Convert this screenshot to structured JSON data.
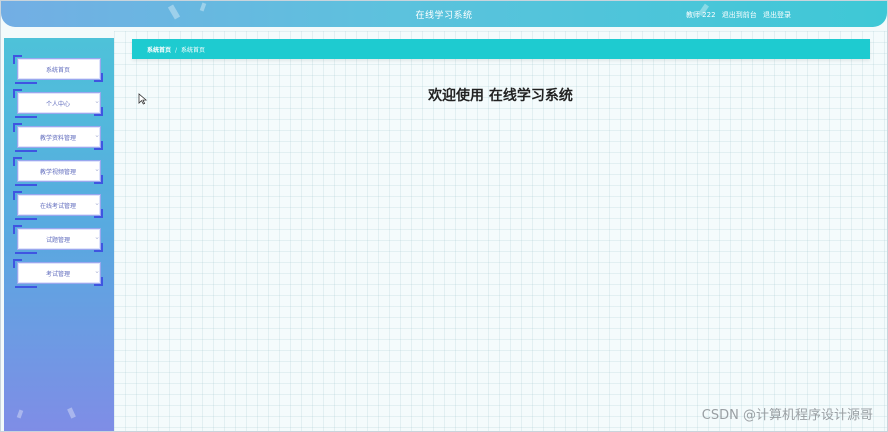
{
  "header": {
    "title": "在线学习系统",
    "user_label": "教师 222",
    "exit_to_front": "退出到前台",
    "logout": "退出登录"
  },
  "sidebar": {
    "items": [
      {
        "label": "系统首页",
        "has_chevron": false
      },
      {
        "label": "个人中心",
        "has_chevron": true
      },
      {
        "label": "教学资料管理",
        "has_chevron": true
      },
      {
        "label": "教学视频管理",
        "has_chevron": true
      },
      {
        "label": "在线考试管理",
        "has_chevron": true
      },
      {
        "label": "试题管理",
        "has_chevron": true
      },
      {
        "label": "考试管理",
        "has_chevron": true
      }
    ],
    "chevron_glyph": "⌄"
  },
  "breadcrumb": {
    "home": "系统首页",
    "separator": "/",
    "current": "系统首页"
  },
  "main": {
    "welcome": "欢迎使用 在线学习系统"
  },
  "watermark": "CSDN @计算机程序设计源哥",
  "colors": {
    "accent": "#1ecbd0",
    "menu_corner": "#3f55e1",
    "menu_text": "#5f6bbd"
  },
  "icons": {
    "cursor": "mouse-pointer-icon",
    "chevron": "chevron-down-icon"
  }
}
